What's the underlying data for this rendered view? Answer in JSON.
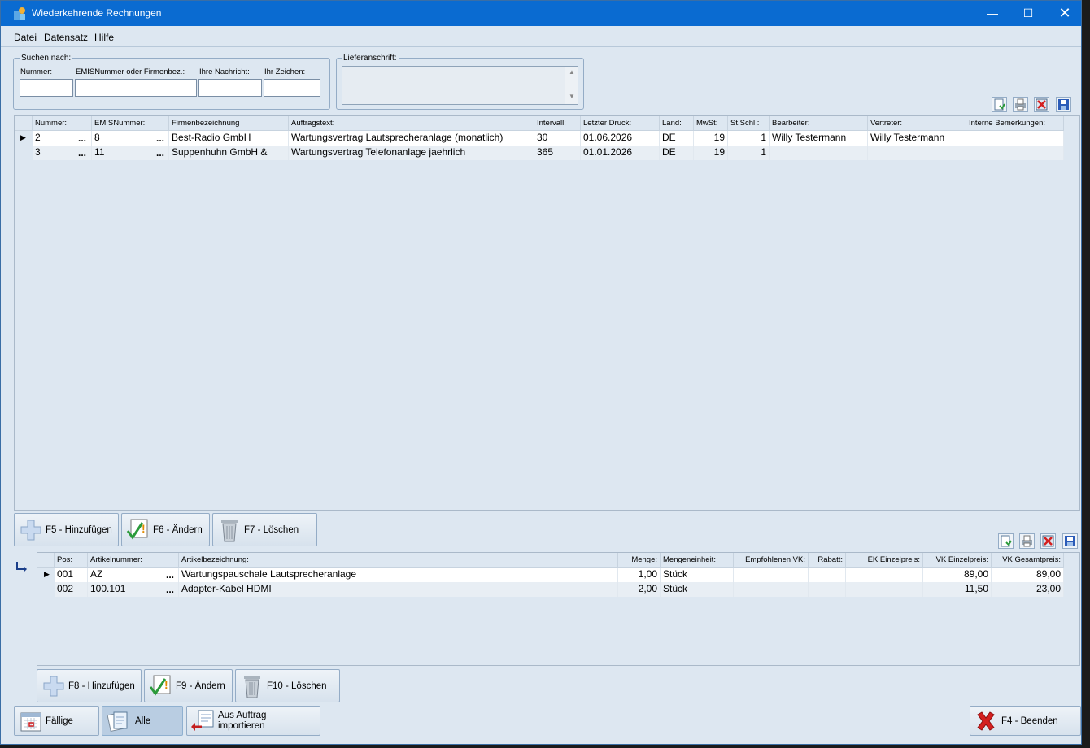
{
  "window": {
    "title": "Wiederkehrende Rechnungen"
  },
  "menu": {
    "items": [
      "Datei",
      "Datensatz",
      "Hilfe"
    ]
  },
  "search": {
    "group_label": "Suchen nach:",
    "nummer_label": "Nummer:",
    "emis_label": "EMISNummer oder Firmenbez.:",
    "nachricht_label": "Ihre Nachricht:",
    "zeichen_label": "Ihr Zeichen:",
    "nummer_value": "",
    "emis_value": "",
    "nachricht_value": "",
    "zeichen_value": ""
  },
  "lieferanschrift": {
    "label": "Lieferanschrift:",
    "value": ""
  },
  "top_grid": {
    "columns": [
      "Nummer:",
      "EMISNummer:",
      "Firmenbezeichnung",
      "Auftragstext:",
      "Intervall:",
      "Letzter Druck:",
      "Land:",
      "MwSt:",
      "St.Schl.:",
      "Bearbeiter:",
      "Vertreter:",
      "Interne Bemerkungen:"
    ],
    "rows": [
      [
        "2",
        "8",
        "Best-Radio GmbH",
        "Wartungsvertrag Lautsprecheranlage (monatlich)",
        "30",
        "01.06.2026",
        "DE",
        "19",
        "1",
        "Willy Testermann",
        "Willy Testermann",
        ""
      ],
      [
        "3",
        "11",
        "Suppenhuhn GmbH &",
        "Wartungsvertrag Telefonanlage jaehrlich",
        "365",
        "01.01.2026",
        "DE",
        "19",
        "1",
        "",
        "",
        ""
      ]
    ]
  },
  "top_buttons": {
    "add": "F5 - Hinzufügen",
    "edit": "F6 - Ändern",
    "delete": "F7 - Löschen"
  },
  "bottom_grid": {
    "columns": [
      "Pos:",
      "Artikelnummer:",
      "Artikelbezeichnung:",
      "Menge:",
      "Mengeneinheit:",
      "Empfohlenen VK:",
      "Rabatt:",
      "EK Einzelpreis:",
      "VK Einzelpreis:",
      "VK Gesamtpreis:"
    ],
    "rows": [
      [
        "001",
        "AZ",
        "Wartungspauschale Lautsprecheranlage",
        "1,00",
        "Stück",
        "",
        "",
        "",
        "89,00",
        "89,00"
      ],
      [
        "002",
        "100.101",
        "Adapter-Kabel HDMI",
        "2,00",
        "Stück",
        "",
        "",
        "",
        "11,50",
        "23,00"
      ]
    ]
  },
  "bottom_buttons": {
    "add": "F8 - Hinzufügen",
    "edit": "F9 - Ändern",
    "delete": "F10 - Löschen"
  },
  "footer": {
    "faellige": "Fällige",
    "alle": "Alle",
    "import_line1": "Aus Auftrag",
    "import_line2": "importieren",
    "exit": "F4 - Beenden"
  },
  "colors": {
    "titlebar": "#0a6bd1",
    "window_bg": "#dde7f1",
    "active_button": "#b9cde2"
  }
}
